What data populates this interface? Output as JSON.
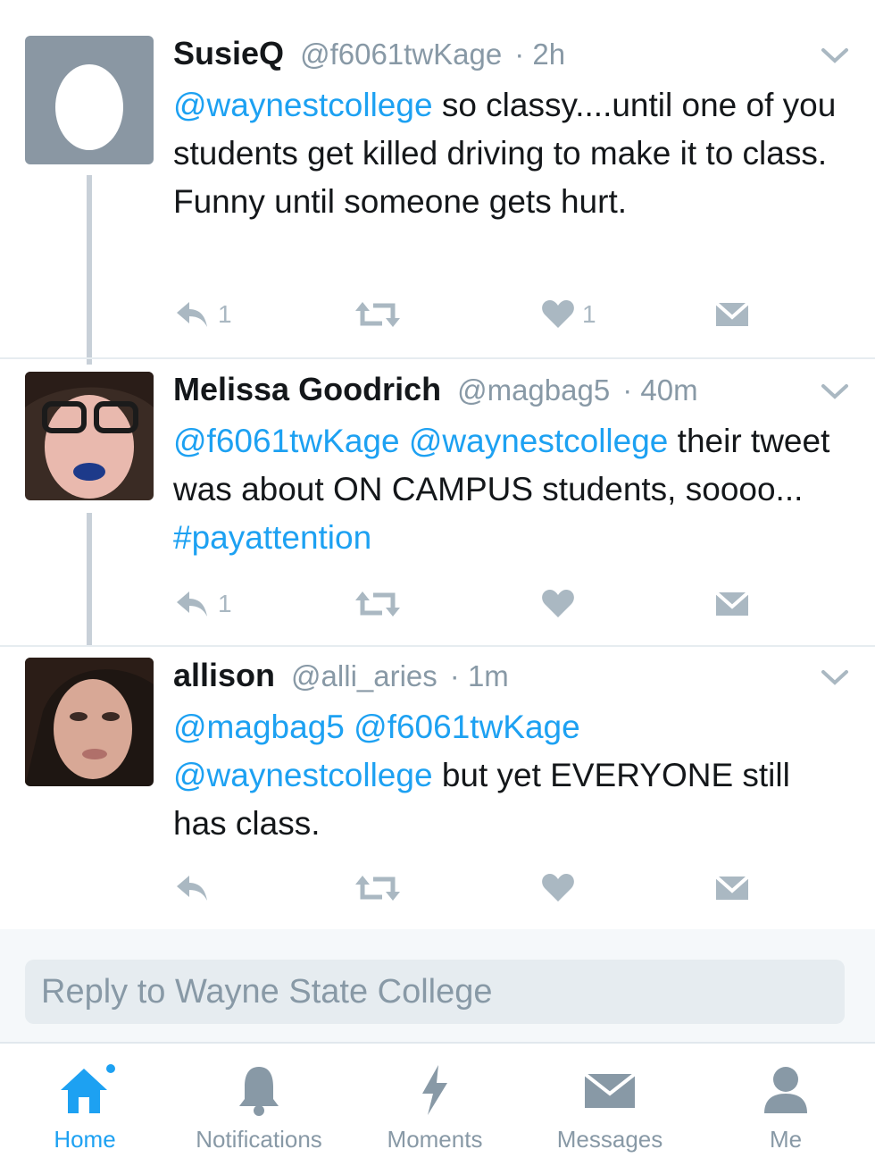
{
  "colors": {
    "accent": "#1da1f2",
    "secondary_text": "#8899a6",
    "icon_gray": "#aab8c2"
  },
  "tweets": [
    {
      "name": "SusieQ",
      "handle": "@f6061twKage",
      "time": "· 2h",
      "text": [
        {
          "t": "@waynestcollege",
          "mention": true
        },
        {
          "t": " so classy....until one of you students get killed driving to make it to class. Funny until someone gets hurt.",
          "mention": false
        }
      ],
      "reply_count": "1",
      "like_count": "1",
      "avatar_icon": "egg-avatar-icon"
    },
    {
      "name": "Melissa Goodrich",
      "handle": "@magbag5",
      "time": "· 40m",
      "text": [
        {
          "t": "@f6061twKage",
          "mention": true
        },
        {
          "t": " ",
          "mention": false
        },
        {
          "t": "@waynestcollege",
          "mention": true
        },
        {
          "t": " their tweet was about ON CAMPUS students, soooo... ",
          "mention": false
        },
        {
          "t": "#payattention",
          "mention": true
        }
      ],
      "reply_count": "1",
      "like_count": ""
    },
    {
      "name": "allison",
      "handle": "@alli_aries",
      "time": "· 1m",
      "text": [
        {
          "t": "@magbag5",
          "mention": true
        },
        {
          "t": " ",
          "mention": false
        },
        {
          "t": "@f6061twKage",
          "mention": true
        },
        {
          "t": " ",
          "mention": false
        },
        {
          "t": "@waynestcollege",
          "mention": true
        },
        {
          "t": " but yet EVERYONE still has class.",
          "mention": false
        }
      ],
      "reply_count": "",
      "like_count": ""
    }
  ],
  "reply": {
    "placeholder": "Reply to Wayne State College"
  },
  "tabs": [
    {
      "label": "Home",
      "icon": "home-icon",
      "active": true
    },
    {
      "label": "Notifications",
      "icon": "bell-icon",
      "active": false
    },
    {
      "label": "Moments",
      "icon": "lightning-icon",
      "active": false
    },
    {
      "label": "Messages",
      "icon": "envelope-icon",
      "active": false
    },
    {
      "label": "Me",
      "icon": "person-icon",
      "active": false
    }
  ]
}
